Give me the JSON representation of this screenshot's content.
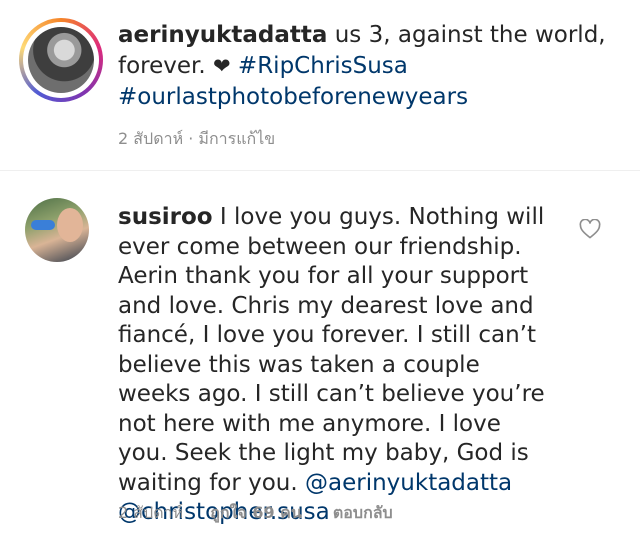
{
  "post": {
    "username": "aerinyuktadatta",
    "caption_text": "us 3, against the world, forever.",
    "heart_emoji": "❤",
    "hashtag_1": "#RipChrisSusa",
    "hashtag_2": "#ourlastphotobeforenewyears",
    "time_ago": "2 สัปดาห์",
    "separator": "·",
    "edited_label": "มีการแก้ไข"
  },
  "comment": {
    "username": "susiroo",
    "text": "I love you guys. Nothing will ever come between our friendship. Aerin thank you for all your support and love. Chris my dearest love and fiancé, I love you forever. I still can’t believe this was taken a couple weeks ago. I still can’t believe you’re not here with me anymore. I love you. Seek the light my baby, God is waiting for you.",
    "mention_1": "@aerinyuktadatta",
    "mention_2": "@christopher.susa",
    "time_ago": "2 สัปดาห์",
    "likes_label": "ถูกใจ 69 คน",
    "reply_label": "ตอบกลับ"
  },
  "colors": {
    "text": "#262626",
    "link": "#00376b",
    "meta": "#8e8e8e"
  }
}
